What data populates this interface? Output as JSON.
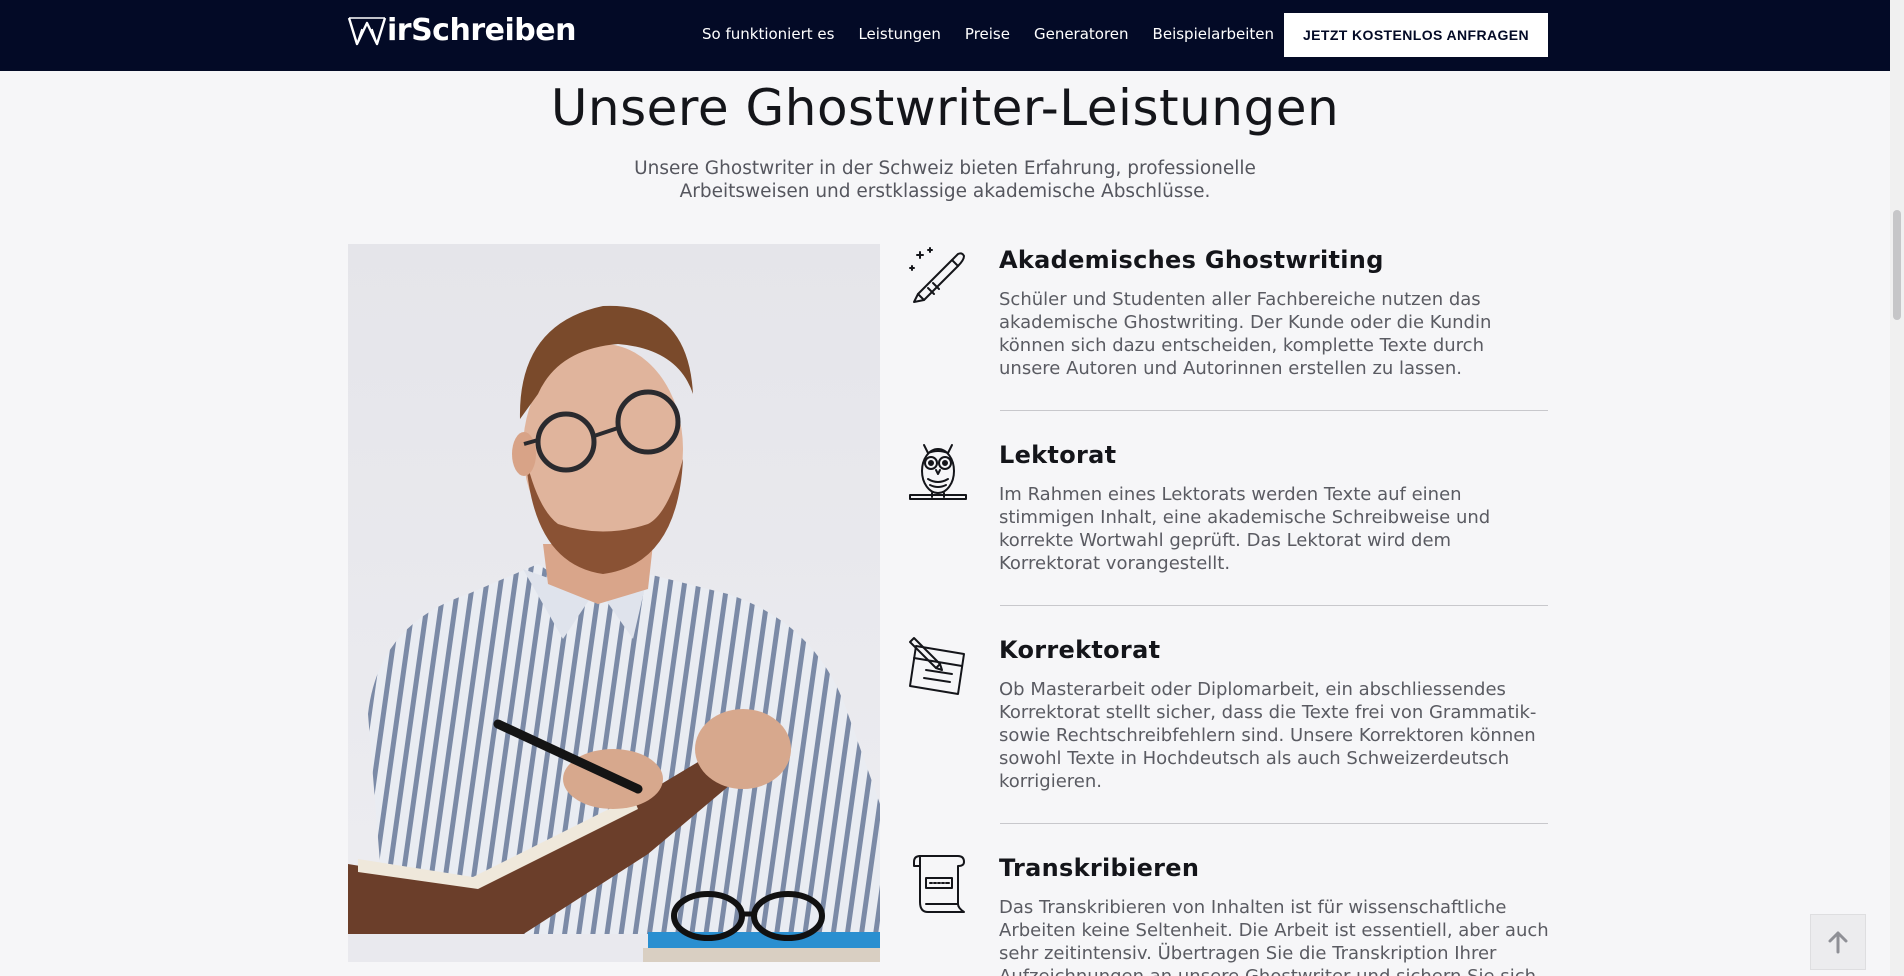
{
  "header": {
    "logo_text": "irSchreiben",
    "nav": [
      {
        "label": "So funktioniert es"
      },
      {
        "label": "Leistungen"
      },
      {
        "label": "Preise"
      },
      {
        "label": "Generatoren"
      },
      {
        "label": "Beispielarbeiten"
      }
    ],
    "cta_label": "JETZT KOSTENLOS ANFRAGEN"
  },
  "main": {
    "title": "Unsere Ghostwriter-Leistungen",
    "intro": "Unsere Ghostwriter in der Schweiz bieten Erfahrung, professionelle Arbeitsweisen und erstklassige akademische Abschlüsse.",
    "services": [
      {
        "icon": "pen-icon",
        "title": "Akademisches Ghostwriting",
        "text": "Schüler und Studenten aller Fachbereiche nutzen das akademische Ghostwriting. Der Kunde oder die Kundin können sich dazu entscheiden, komplette Texte durch unsere Autoren und Autorinnen erstellen zu lassen."
      },
      {
        "icon": "owl-icon",
        "title": "Lektorat",
        "text": "Im Rahmen eines Lektorats werden Texte auf einen stimmigen Inhalt, eine akademische Schreibweise und korrekte Wortwahl geprüft. Das Lektorat wird dem Korrektorat vorangestellt."
      },
      {
        "icon": "notepad-pen-icon",
        "title": "Korrektorat",
        "text": "Ob Masterarbeit oder Diplomarbeit, ein abschliessendes Korrektorat stellt sicher, dass die Texte frei von Grammatik- sowie Rechtschreibfehlern sind. Unsere Korrektoren können sowohl Texte in Hochdeutsch als auch Schweizerdeutsch korrigieren."
      },
      {
        "icon": "scroll-icon",
        "title": "Transkribieren",
        "text": "Das Transkribieren von Inhalten ist für wissenschaftliche Arbeiten keine Seltenheit. Die Arbeit ist essentiell, aber auch sehr zeitintensiv. Übertragen Sie die Transkription Ihrer Aufzeichnungen an unsere Ghostwriter und sichern Sie sich"
      }
    ]
  },
  "colors": {
    "header_bg": "#030a26",
    "page_bg": "#f6f6f8",
    "cta_bg": "#ffffff"
  }
}
